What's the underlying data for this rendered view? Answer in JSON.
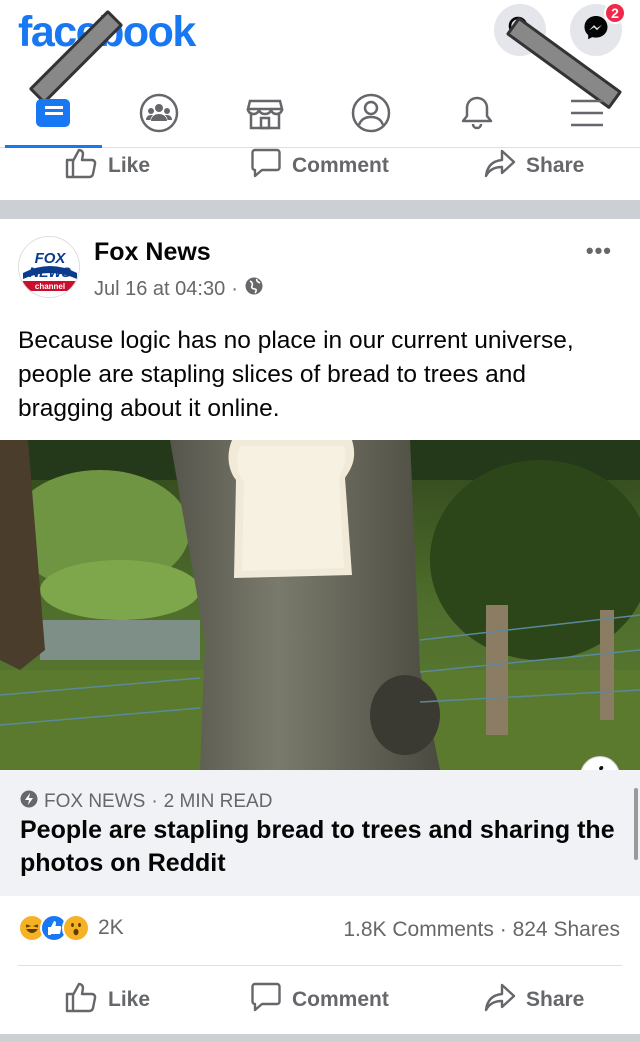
{
  "header": {
    "logo": "facebook",
    "messenger_badge": "2",
    "icons": [
      "search-icon",
      "messenger-icon"
    ]
  },
  "nav": {
    "tabs": [
      "news-feed",
      "groups",
      "marketplace",
      "profile",
      "notifications",
      "menu"
    ],
    "active": "news-feed"
  },
  "previous_post_actions": {
    "like": "Like",
    "comment": "Comment",
    "share": "Share"
  },
  "post": {
    "author": "Fox News",
    "avatar_text": {
      "line1": "FOX",
      "line2": "NEWS",
      "line3": "channel"
    },
    "timestamp": "Jul 16 at 04:30",
    "timestamp_sep": "·",
    "privacy_icon": "globe-icon",
    "more_label": "•••",
    "text": "Because logic has no place in our current universe, people are stapling slices of bread to trees and bragging about it online.",
    "link": {
      "source": "FOX NEWS",
      "source_sep": "·",
      "read_time": "2 MIN READ",
      "title": "People are stapling bread to trees and sharing the photos on Reddit"
    },
    "reactions": {
      "types": [
        "haha",
        "like",
        "wow"
      ],
      "count": "2K"
    },
    "comments_count": "1.8K Comments",
    "counts_sep": "·",
    "shares_count": "824 Shares",
    "actions": {
      "like": "Like",
      "comment": "Comment",
      "share": "Share"
    }
  },
  "colors": {
    "brand": "#1877f2",
    "badge": "#f02849",
    "secondary_text": "#65676b",
    "separator": "#ccd0d5",
    "link_card_bg": "#f0f2f5"
  }
}
